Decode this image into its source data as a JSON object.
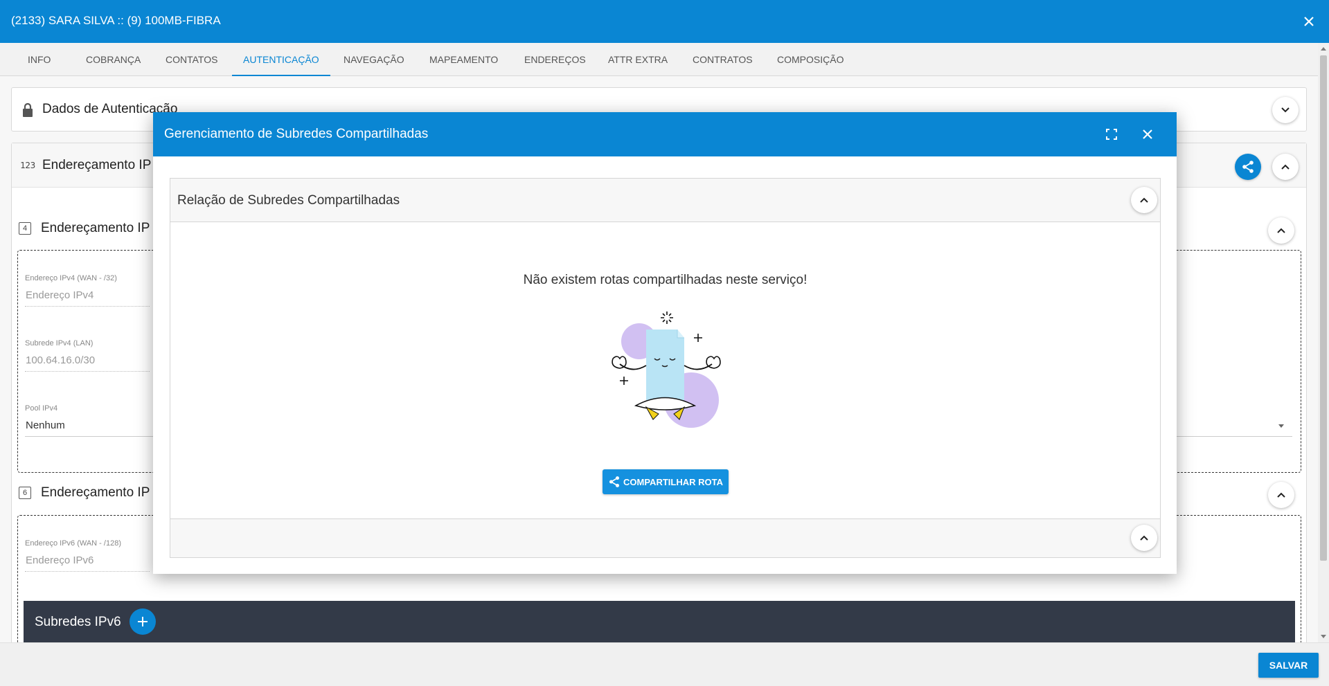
{
  "window": {
    "title": "(2133) SARA SILVA :: (9) 100MB-FIBRA",
    "close_icon": "close-icon"
  },
  "tabs": [
    {
      "label": "INFO",
      "active": false
    },
    {
      "label": "COBRANÇA",
      "active": false
    },
    {
      "label": "CONTATOS",
      "active": false
    },
    {
      "label": "AUTENTICAÇÃO",
      "active": true
    },
    {
      "label": "NAVEGAÇÃO",
      "active": false
    },
    {
      "label": "MAPEAMENTO",
      "active": false
    },
    {
      "label": "ENDEREÇOS",
      "active": false
    },
    {
      "label": "ATTR EXTRA",
      "active": false
    },
    {
      "label": "CONTRATOS",
      "active": false
    },
    {
      "label": "COMPOSIÇÃO",
      "active": false
    }
  ],
  "background": {
    "auth_card_title": "Dados de Autenticação",
    "addr_card_title": "Endereçamento IP",
    "ipv4_section_title": "Endereçamento IP",
    "ipv4_icon_text": "4",
    "ipv4_wan_label": "Endereço IPv4 (WAN - /32)",
    "ipv4_wan_placeholder": "Endereço IPv4",
    "ipv4_lan_label": "Subrede IPv4 (LAN)",
    "ipv4_lan_value": "100.64.16.0/30",
    "pool_label": "Pool IPv4",
    "pool_value": "Nenhum",
    "ipv6_section_title": "Endereçamento IP",
    "ipv6_icon_text": "6",
    "ipv6_wan_label": "Endereço IPv6 (WAN - /128)",
    "ipv6_wan_placeholder": "Endereço IPv6",
    "subnets_ipv6_label": "Subredes IPv6"
  },
  "footer": {
    "save_label": "SALVAR"
  },
  "modal": {
    "title": "Gerenciamento de Subredes Compartilhadas",
    "panel_title": "Relação de Subredes Compartilhadas",
    "empty_message": "Não existem rotas compartilhadas neste serviço!",
    "share_button_label": "COMPARTILHAR ROTA"
  },
  "colors": {
    "primary": "#0a86d3",
    "dark_bar": "#333a48"
  }
}
